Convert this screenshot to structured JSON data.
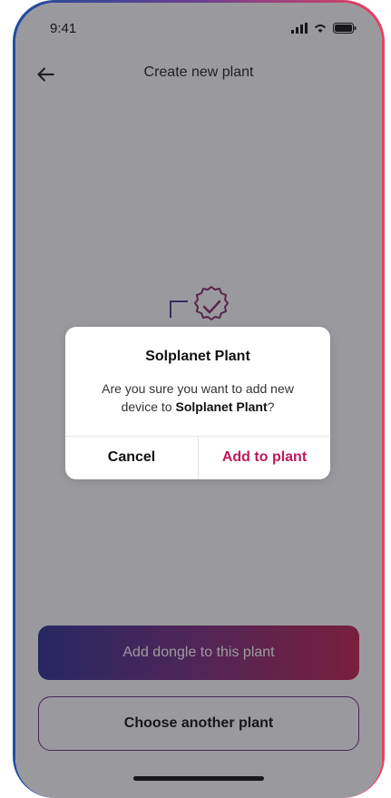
{
  "status_bar": {
    "time": "9:41",
    "signal_icon": "signal-icon",
    "wifi_icon": "wifi-icon",
    "battery_icon": "battery-icon"
  },
  "header": {
    "title": "Create new plant",
    "back_icon": "arrow-left-icon"
  },
  "illustration": {
    "icon": "verified-badge-icon"
  },
  "actions": {
    "primary_label": "Add dongle to this plant",
    "secondary_label": "Choose another plant"
  },
  "dialog": {
    "title": "Solplanet Plant",
    "message_prefix": "Are you sure you want to add new device to ",
    "message_bold": "Solplanet Plant",
    "message_suffix": "?",
    "cancel_label": "Cancel",
    "confirm_label": "Add to plant"
  },
  "colors": {
    "accent": "#c2185b",
    "gradient_start": "#2d2f93",
    "gradient_end": "#c2204d",
    "overlay": "rgba(30,30,40,0.45)"
  }
}
